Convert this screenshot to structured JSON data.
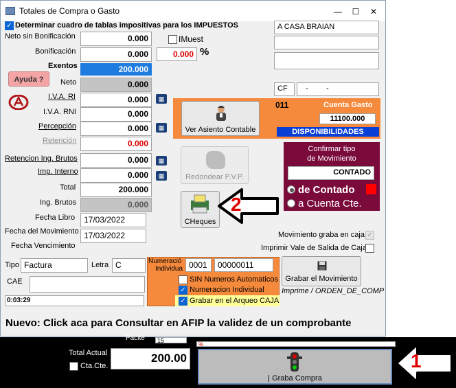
{
  "window": {
    "title": "Totales de Compra o Gasto",
    "minimize": "—",
    "maximize": "☐",
    "close": "✕"
  },
  "top_checkbox_label": "Determinar cuadro de tablas impositivas para los IMPUESTOS",
  "fields": {
    "neto_sin_bonif": {
      "label": "Neto sin Bonificación",
      "value": "0.000"
    },
    "bonificacion": {
      "label": "Bonificación",
      "value": "0.000"
    },
    "bonif_pct": "0.000",
    "pct_sign": "%",
    "imuest_label": "IMuest",
    "exentos": {
      "label": "Exentos",
      "value": "200.000"
    },
    "neto": {
      "label": "Neto",
      "value": "0.000"
    },
    "iva_ri": {
      "label": "I.V.A. RI",
      "value": "0.000"
    },
    "iva_rni": {
      "label": "I.V.A. RNI",
      "value": "0.000"
    },
    "percepcion": {
      "label": "Percepción",
      "value": "0.000"
    },
    "retencion": {
      "label": "Retención",
      "value": "0.000"
    },
    "ret_ing_brutos": {
      "label": "Retencion Ing. Brutos",
      "value": "0.000"
    },
    "imp_interno": {
      "label": "Imp. Interno",
      "value": "0.000"
    },
    "total": {
      "label": "Total",
      "value": "200.000"
    },
    "ing_brutos": {
      "label": "Ing. Brutos",
      "value": "0.000"
    }
  },
  "ayuda_label": "Ayuda ?",
  "calc_glyph": "▦",
  "provider": {
    "name": "A CASA BRAIAN",
    "line2": "",
    "line3": "",
    "iva_cond": "CF",
    "cuit_a": "-",
    "cuit_b": "-"
  },
  "asiento": {
    "code": "011",
    "cuenta_label": "Cuenta Gasto",
    "cuenta_value": "11100.000",
    "disponibilidades": "DISPONIBILIDADES",
    "button_label": "Ver Asiento Contable"
  },
  "redondear_label": "Redondear P.V.P.",
  "cheques_label": "CHeques",
  "pago": {
    "title_line1": "Confirmar tipo",
    "title_line2": "de Movimiento",
    "value": "CONTADO",
    "opt_contado": "de Contado",
    "opt_cuenta": "a Cuenta Cte."
  },
  "fechas": {
    "libro_label": "Fecha Libro",
    "libro": "17/03/2022",
    "mov_label": "Fecha del Movimiento",
    "mov": "17/03/2022",
    "venc_label": "Fecha Vencimiento"
  },
  "mov_caja_label": "Movimiento graba en caja",
  "vale_label": "Imprimir Vale de Salida de Caja",
  "tipo_label": "Tipo",
  "tipo": "Factura",
  "letra_label": "Letra",
  "letra": "C",
  "cae_label": "CAE",
  "numeracion": {
    "label_line1": "Numeració",
    "label_line2": "Individua",
    "pv": "0001",
    "nro": "00000011",
    "sin_auto": "SIN Numeros Automaticos",
    "individual": "Numeracion Individual",
    "arqueo": "Grabar en el Arqueo CAJA"
  },
  "grabar_label": "Grabar el  Movimiento",
  "imprime_label": "Imprime / ORDEN_DE_COMP",
  "time": "0:03:29",
  "afip_banner": "Nuevo: Click aca para Consultar en AFIP la validez de un comprobante",
  "bottom": {
    "partial_label": "Pacite",
    "partial_value": "15",
    "total_label": "Total Actual",
    "total_value": "200.00",
    "ctacte_label": "Cta.Cte.",
    "graba_label": "| Graba Compra",
    "small_mark": "%"
  },
  "annotations": {
    "one": "1",
    "two": "2"
  },
  "colors": {
    "accent_blue": "#0a64d4",
    "orange_panel": "#f58a3c",
    "maroon_panel": "#7a0a3a",
    "selected_blue": "#1e7be0",
    "annotation_red": "#e00000"
  }
}
